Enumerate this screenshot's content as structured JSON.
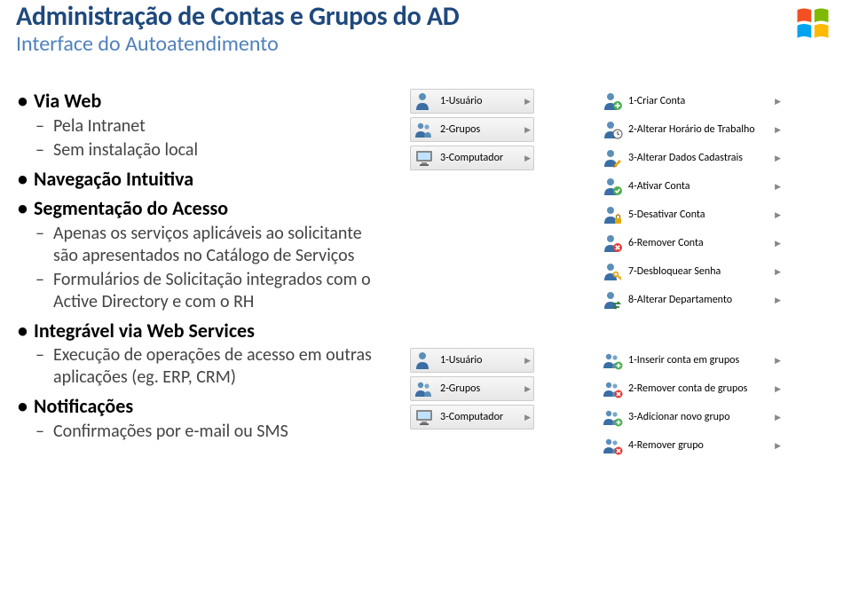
{
  "title": "Administração de Contas e Grupos do AD",
  "subtitle": "Interface do Autoatendimento",
  "bullets": [
    {
      "label": "Via Web",
      "sub": [
        {
          "label": "Pela Intranet"
        },
        {
          "label": "Sem instalação local"
        }
      ]
    },
    {
      "label": "Navegação Intuitiva"
    },
    {
      "label": "Segmentação do Acesso",
      "sub": [
        {
          "label": "Apenas os serviços aplicáveis ao solicitante são apresentados no Catálogo de Serviços"
        },
        {
          "label": "Formulários de Solicitação integrados com o Active Directory e com o RH"
        }
      ]
    },
    {
      "label": "Integrável via Web Services",
      "sub": [
        {
          "label": "Execução de operações de acesso em outras aplicações (eg. ERP, CRM)"
        }
      ]
    },
    {
      "label": "Notificações",
      "sub": [
        {
          "label": "Confirmações por e-mail ou SMS"
        }
      ]
    }
  ],
  "figure1": {
    "left": [
      {
        "icon": "user",
        "label": "1-Usuário"
      },
      {
        "icon": "users",
        "label": "2-Grupos"
      },
      {
        "icon": "computer",
        "label": "3-Computador"
      }
    ],
    "right": [
      {
        "icon": "user-plus",
        "label": "1-Criar Conta"
      },
      {
        "icon": "clock",
        "label": "2-Alterar Horário de Trabalho"
      },
      {
        "icon": "pencil",
        "label": "3-Alterar Dados Cadastrais"
      },
      {
        "icon": "user-check",
        "label": "4-Ativar Conta"
      },
      {
        "icon": "user-lock",
        "label": "5-Desativar Conta"
      },
      {
        "icon": "user-x-red",
        "label": "6-Remover Conta"
      },
      {
        "icon": "key",
        "label": "7-Desbloquear Senha"
      },
      {
        "icon": "swap",
        "label": "8-Alterar Departamento"
      }
    ]
  },
  "figure2": {
    "left": [
      {
        "icon": "user",
        "label": "1-Usuário"
      },
      {
        "icon": "users",
        "label": "2-Grupos"
      },
      {
        "icon": "computer",
        "label": "3-Computador"
      }
    ],
    "right": [
      {
        "icon": "users-plus",
        "label": "1-Inserir conta em grupos"
      },
      {
        "icon": "users-x",
        "label": "2-Remover conta de grupos"
      },
      {
        "icon": "users-add",
        "label": "3-Adicionar novo grupo"
      },
      {
        "icon": "users-x-red",
        "label": "4-Remover grupo"
      }
    ]
  }
}
